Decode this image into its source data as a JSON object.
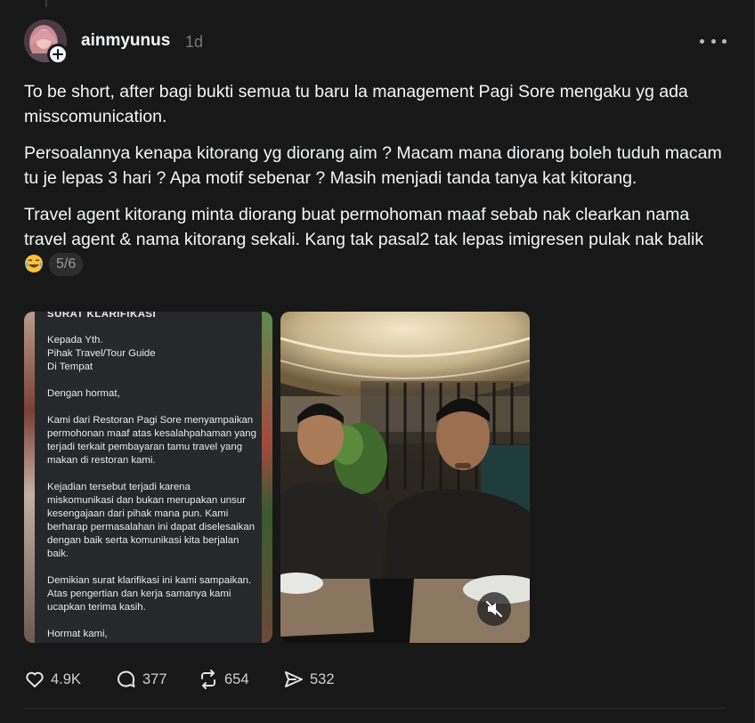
{
  "post": {
    "username": "ainmyunus",
    "timestamp": "1d",
    "paragraphs": [
      "To be short, after bagi bukti semua tu baru la management Pagi Sore mengaku yg ada misscomunication.",
      "Persoalannya kenapa kitorang yg diorang aim ? Macam mana diorang boleh tuduh macam tu je lepas 3 hari ? Apa motif sebenar ? Masih menjadi tanda tanya kat kitorang.",
      "Travel agent kitorang minta diorang buat permohoman maaf sebab nak clearkan nama travel agent & nama kitorang sekali. Kang tak pasal2 tak lepas imigresen pulak nak balik"
    ],
    "emoji": "laughing-tears-emoji",
    "pager": "5/6"
  },
  "document": {
    "heading": "SURAT KLARIFIKASI",
    "address": [
      "Kepada Yth.",
      "Pihak Travel/Tour Guide",
      "Di Tempat"
    ],
    "greeting": "Dengan hormat,",
    "para1": [
      "Kami dari Restoran Pagi Sore menyampaikan",
      "permohonan maaf atas kesalahpahaman yang",
      "terjadi terkait pembayaran tamu travel yang",
      "makan di restoran kami."
    ],
    "para2": [
      "Kejadian tersebut terjadi karena",
      "miskomunikasi dan bukan merupakan unsur",
      "kesengajaan dari pihak mana pun. Kami",
      "berharap permasalahan ini dapat diselesaikan",
      "dengan baik serta komunikasi kita berjalan",
      "baik."
    ],
    "para3": [
      "Demikian surat klarifikasi ini kami sampaikan.",
      "Atas pengertian dan kerja samanya kami",
      "ucapkan terima kasih."
    ],
    "closing": "Hormat kami,"
  },
  "video": {
    "mute_icon": "speaker-muted-icon"
  },
  "actions": {
    "likes": "4.9K",
    "replies": "377",
    "reposts": "654",
    "shares": "532"
  },
  "colors": {
    "background": "#181818",
    "text": "#f3f5f7",
    "muted": "#777777"
  }
}
